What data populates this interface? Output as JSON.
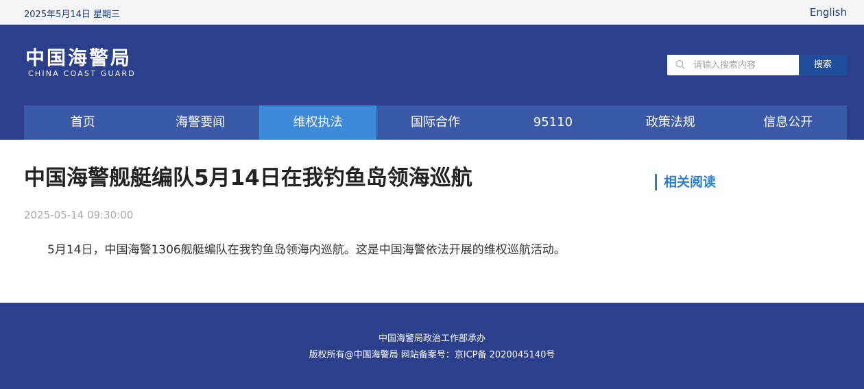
{
  "topbar": {
    "date": "2025年5月14日 星期三",
    "language_link": "English"
  },
  "logo": {
    "cn": "中国海警局",
    "en": "CHINA COAST GUARD"
  },
  "search": {
    "placeholder": "请输入搜索内容",
    "button_label": "搜索",
    "icon": "search-icon"
  },
  "nav": {
    "items": [
      {
        "label": "首页"
      },
      {
        "label": "海警要闻"
      },
      {
        "label": "维权执法"
      },
      {
        "label": "国际合作"
      },
      {
        "label": "95110"
      },
      {
        "label": "政策法规"
      },
      {
        "label": "信息公开"
      }
    ],
    "active_index": 2
  },
  "article": {
    "title": "中国海警舰艇编队5月14日在我钓鱼岛领海巡航",
    "timestamp": "2025-05-14 09:30:00",
    "body": "5月14日，中国海警1306舰艇编队在我钓鱼岛领海内巡航。这是中国海警依法开展的维权巡航活动。"
  },
  "sidebar": {
    "related_title": "相关阅读"
  },
  "footer": {
    "organizer": "中国海警局政治工作部承办",
    "copyright": "版权所有@中国海警局 网站备案号：京ICP备 2020045140号"
  },
  "colors": {
    "header_bg": "#2c3f8c",
    "nav_bg": "#3a5aa8",
    "nav_active": "#3d8ad9",
    "accent": "#2a7fd4",
    "search_button": "#1f4f9c"
  }
}
